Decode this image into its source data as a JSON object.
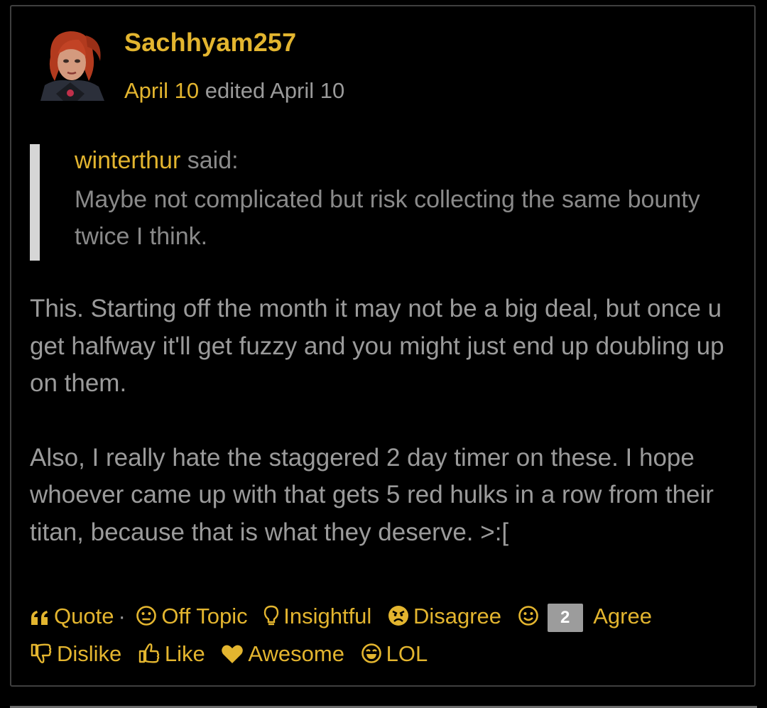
{
  "post": {
    "author": "Sachhyam257",
    "date": "April 10",
    "edited": "edited April 10",
    "quote": {
      "author": "winterthur",
      "said": "said:",
      "text": "Maybe not complicated but risk collecting the same bounty twice I think."
    },
    "paragraphs": [
      "This. Starting off the month it may not be a big deal, but once u get halfway it'll get fuzzy and you might just end up doubling up on them.",
      "Also, I really hate the staggered 2 day timer on these. I hope whoever came up with that gets 5 red hulks in a row from their titan, because that is what they deserve. >:["
    ]
  },
  "reactions": {
    "quote": "Quote",
    "separator": "·",
    "off_topic": "Off Topic",
    "insightful": "Insightful",
    "disagree": "Disagree",
    "agree_count": "2",
    "agree": "Agree",
    "dislike": "Dislike",
    "like": "Like",
    "awesome": "Awesome",
    "lol": "LOL"
  },
  "colors": {
    "accent": "#e3b52f",
    "text": "#9b9b9b",
    "quote_bar": "#d6d6d6",
    "border": "#3f3f3f"
  }
}
